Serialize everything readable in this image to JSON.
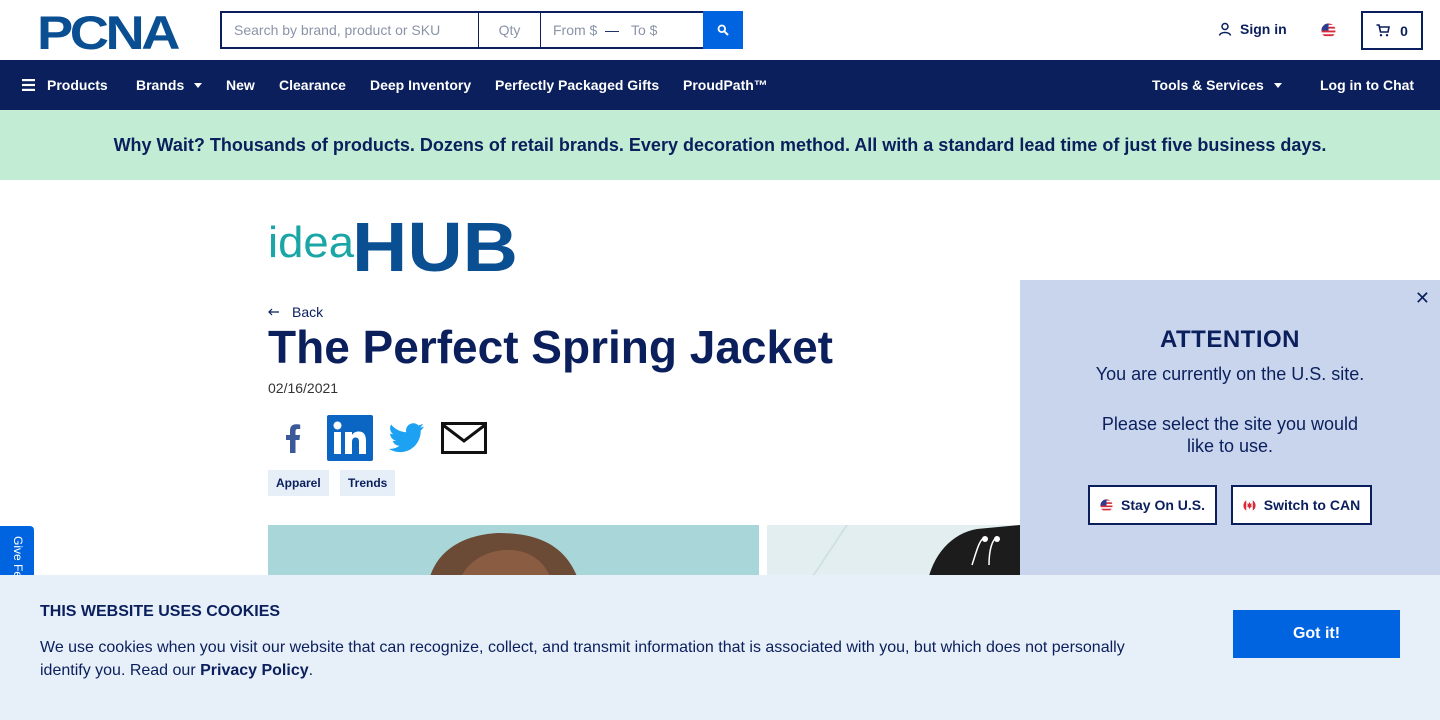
{
  "header": {
    "logo_text": "PCNA",
    "search": {
      "keyword_placeholder": "Search by brand, product or SKU",
      "qty_placeholder": "Qty",
      "from_placeholder": "From $",
      "to_placeholder": "To $"
    },
    "signin_label": "Sign in",
    "cart_count": "0"
  },
  "nav": {
    "products": "Products",
    "brands": "Brands",
    "new": "New",
    "clearance": "Clearance",
    "deep_inventory": "Deep Inventory",
    "gifts": "Perfectly Packaged Gifts",
    "proudpath": "ProudPath™",
    "tools": "Tools & Services",
    "chat": "Log in to Chat"
  },
  "promo": "Why Wait? Thousands of products. Dozens of retail brands. Every decoration method. All with a standard lead time of just five business days.",
  "article": {
    "logo_text": {
      "idea": "idea",
      "hub": "HUB"
    },
    "back_label": "Back",
    "title": "The Perfect Spring Jacket",
    "date": "02/16/2021",
    "tags": [
      "Apparel",
      "Trends"
    ]
  },
  "feedback_label": "Give Feedback",
  "modal": {
    "title": "ATTENTION",
    "line1": "You are currently on the U.S. site.",
    "line2": "Please select the site you would like to use.",
    "stay_label": "Stay On U.S.",
    "switch_label": "Switch to CAN"
  },
  "cookie": {
    "title": "THIS WEBSITE USES COOKIES",
    "text": "We use cookies when you visit our website that can recognize, collect, and transmit information that is associated with you, but which does not personally identify you. Read our ",
    "link": "Privacy Policy",
    "suffix": ".",
    "button": "Got it!"
  },
  "colors": {
    "navy": "#0a1f5c",
    "accent_blue": "#0064e0",
    "promo_green": "#c2edd4",
    "modal_bg": "#c8d5ed",
    "cookie_bg": "#e7eff9",
    "idea_teal": "#1aa5a6"
  }
}
